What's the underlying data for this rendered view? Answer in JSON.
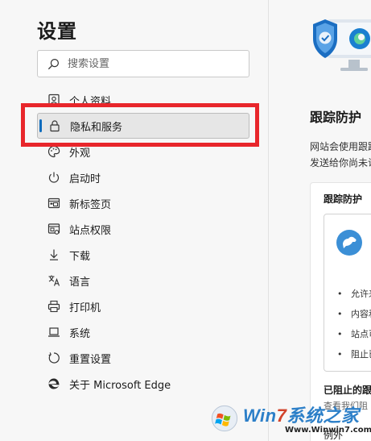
{
  "sidebar": {
    "title": "设置",
    "search": {
      "placeholder": "搜索设置",
      "value": ""
    },
    "items": [
      {
        "label": "个人资料",
        "icon": "profile-icon",
        "active": false
      },
      {
        "label": "隐私和服务",
        "icon": "lock-icon",
        "active": true
      },
      {
        "label": "外观",
        "icon": "palette-icon",
        "active": false
      },
      {
        "label": "启动时",
        "icon": "power-icon",
        "active": false
      },
      {
        "label": "新标签页",
        "icon": "new-tab-icon",
        "active": false
      },
      {
        "label": "站点权限",
        "icon": "site-permissions-icon",
        "active": false
      },
      {
        "label": "下载",
        "icon": "download-icon",
        "active": false
      },
      {
        "label": "语言",
        "icon": "language-icon",
        "active": false
      },
      {
        "label": "打印机",
        "icon": "printer-icon",
        "active": false
      },
      {
        "label": "系统",
        "icon": "laptop-icon",
        "active": false
      },
      {
        "label": "重置设置",
        "icon": "reset-icon",
        "active": false
      },
      {
        "label": "关于 Microsoft Edge",
        "icon": "edge-logo-icon",
        "active": false
      }
    ]
  },
  "main": {
    "heading": "跟踪防护",
    "description_lines": [
      "网站会使用跟踪器收集",
      "发送给你尚未访问过的"
    ],
    "card": {
      "title": "跟踪防护",
      "bullets": [
        "允许来",
        "内容和",
        "站点可",
        "阻止已"
      ],
      "blocked_title": "已阻止的跟",
      "blocked_sub": "查看我们阻",
      "example_label": "例外"
    }
  },
  "watermark": {
    "brand_prefix": "Win",
    "brand_number": "7",
    "brand_suffix": "系统之家",
    "url": "Www.Winwin7.com"
  },
  "colors": {
    "accent": "#0f6cbd",
    "highlight": "#e8262b",
    "background": "#f7f7f7"
  }
}
